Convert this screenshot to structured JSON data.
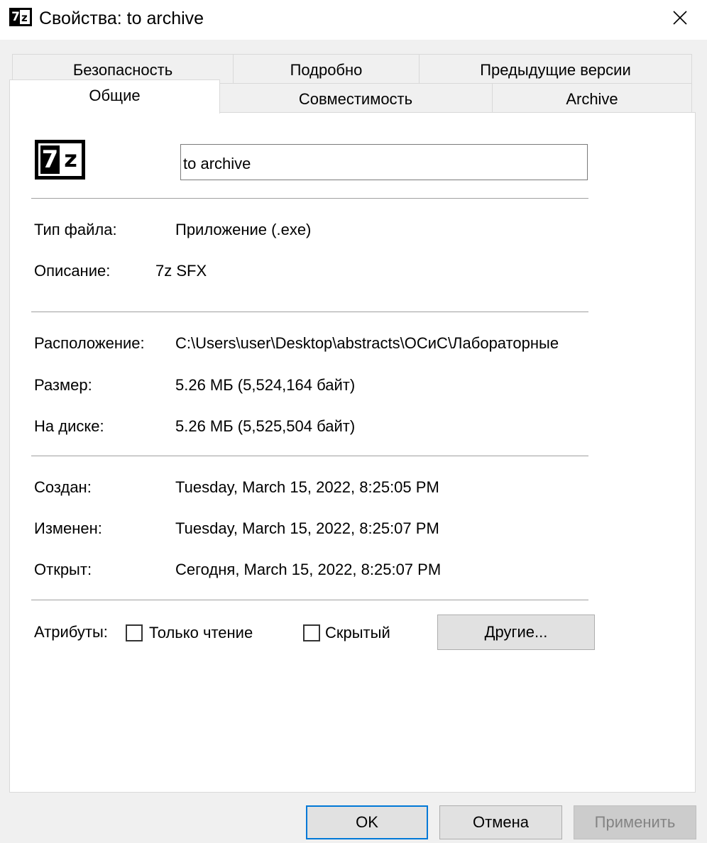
{
  "window": {
    "title": "Свойства: to archive",
    "app_icon": "7z-icon",
    "close_icon": "close-icon"
  },
  "tabs": {
    "row1": [
      "Безопасность",
      "Подробно",
      "Предыдущие версии"
    ],
    "row2": [
      "Общие",
      "Совместимость",
      "Archive"
    ],
    "active": "Общие"
  },
  "general": {
    "icon_glyph_a": "7",
    "icon_glyph_b": "z",
    "file_name": "to archive",
    "file_type_label": "Тип файла:",
    "file_type_value": "Приложение (.exe)",
    "description_label": "Описание:",
    "description_value": "7z SFX",
    "location_label": "Расположение:",
    "location_value": "C:\\Users\\user\\Desktop\\abstracts\\ОСиС\\Лабораторные",
    "size_label": "Размер:",
    "size_value": "5.26 МБ (5,524,164 байт)",
    "size_on_disk_label": "На диске:",
    "size_on_disk_value": "5.26 МБ (5,525,504 байт)",
    "created_label": "Создан:",
    "created_value": "Tuesday, March 15, 2022, 8:25:05 PM",
    "modified_label": "Изменен:",
    "modified_value": "Tuesday, March 15, 2022, 8:25:07 PM",
    "accessed_label": "Открыт:",
    "accessed_value": "Сегодня, March 15, 2022, 8:25:07 PM",
    "attributes_label": "Атрибуты:",
    "readonly_label": "Только чтение",
    "readonly_checked": false,
    "hidden_label": "Скрытый",
    "hidden_checked": false,
    "advanced_button": "Другие..."
  },
  "buttons": {
    "ok": "OK",
    "cancel": "Отмена",
    "apply": "Применить"
  },
  "colors": {
    "focus_border": "#0078d7",
    "disabled_text": "#838383"
  }
}
